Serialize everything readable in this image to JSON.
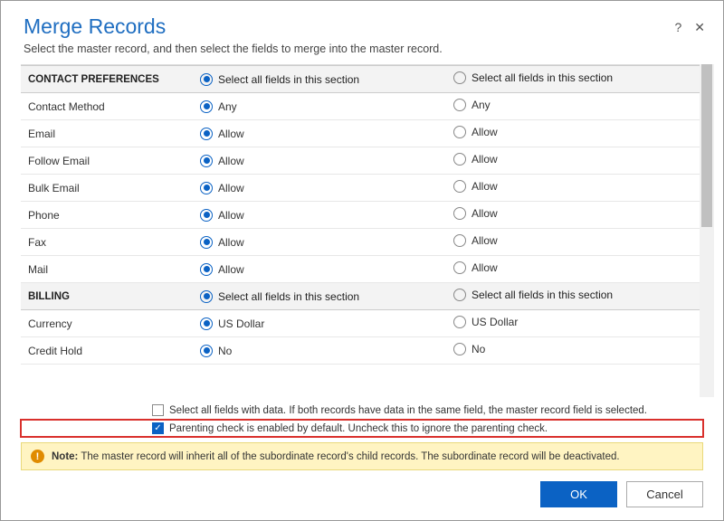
{
  "header": {
    "title": "Merge Records",
    "subtitle": "Select the master record, and then select the fields to merge into the master record."
  },
  "section_select_label": "Select all fields in this section",
  "sections": [
    {
      "name": "CONTACT PREFERENCES",
      "rows": [
        {
          "label": "Contact Method",
          "left": "Any",
          "right": "Any",
          "selected": "left"
        },
        {
          "label": "Email",
          "left": "Allow",
          "right": "Allow",
          "selected": "left"
        },
        {
          "label": "Follow Email",
          "left": "Allow",
          "right": "Allow",
          "selected": "left"
        },
        {
          "label": "Bulk Email",
          "left": "Allow",
          "right": "Allow",
          "selected": "left"
        },
        {
          "label": "Phone",
          "left": "Allow",
          "right": "Allow",
          "selected": "left"
        },
        {
          "label": "Fax",
          "left": "Allow",
          "right": "Allow",
          "selected": "left"
        },
        {
          "label": "Mail",
          "left": "Allow",
          "right": "Allow",
          "selected": "left"
        }
      ],
      "section_selected": "left"
    },
    {
      "name": "BILLING",
      "rows": [
        {
          "label": "Currency",
          "left": "US Dollar",
          "right": "US Dollar",
          "selected": "left"
        },
        {
          "label": "Credit Hold",
          "left": "No",
          "right": "No",
          "selected": "left"
        }
      ],
      "section_selected": "left"
    }
  ],
  "options": {
    "select_all_with_data": {
      "checked": false,
      "label": "Select all fields with data. If both records have data in the same field, the master record field is selected."
    },
    "parenting_check": {
      "checked": true,
      "label": "Parenting check is enabled by default. Uncheck this to ignore the parenting check."
    }
  },
  "note": {
    "prefix": "Note:",
    "text": "The master record will inherit all of the subordinate record's child records. The subordinate record will be deactivated."
  },
  "buttons": {
    "ok": "OK",
    "cancel": "Cancel"
  }
}
